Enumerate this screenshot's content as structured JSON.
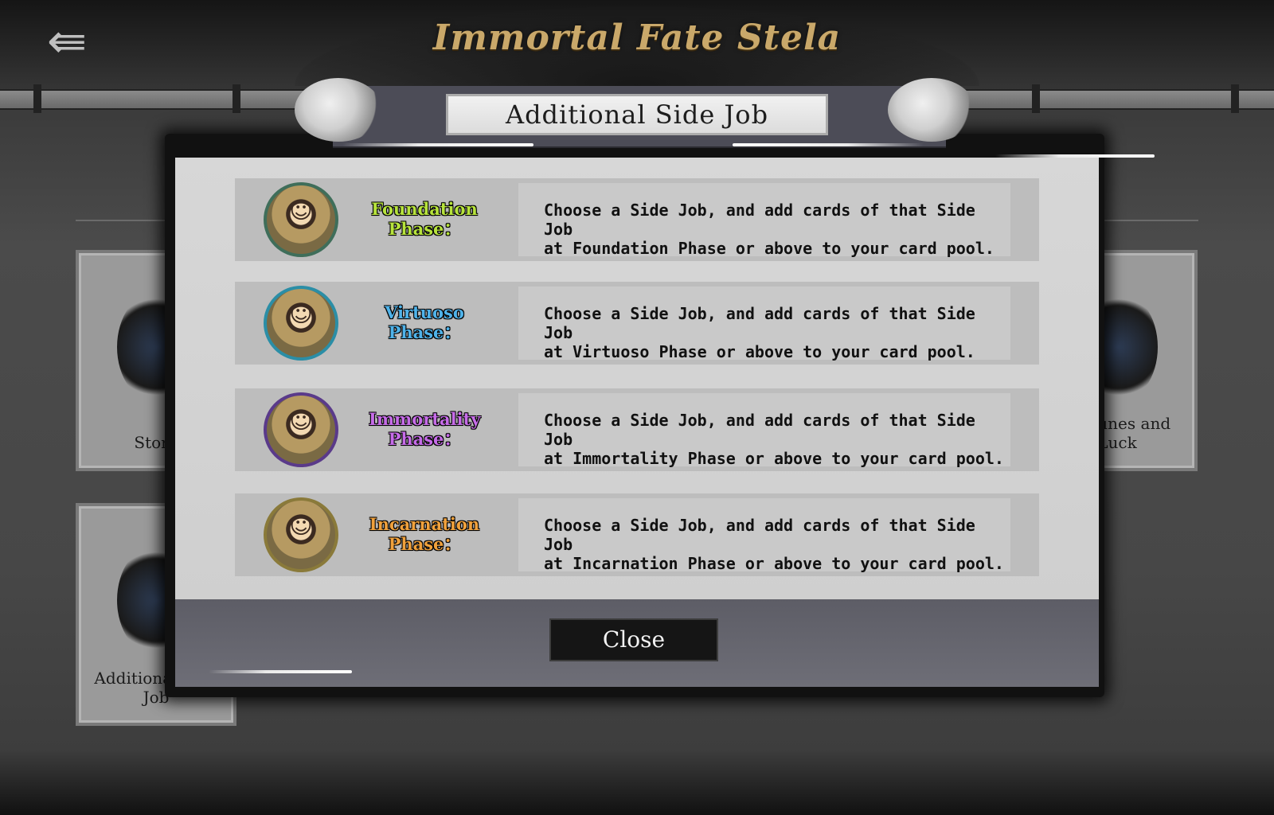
{
  "header": {
    "title": "Immortal Fate Stela",
    "back_icon": "back-arrow-icon",
    "title_color": "#c9a86a"
  },
  "background_cards": [
    {
      "label": "Store"
    },
    {
      "label": "Additional Side\nJob"
    },
    {
      "label": "Fortunes and\nLuck"
    }
  ],
  "modal": {
    "title": "Additional Side Job",
    "rows": [
      {
        "phase": "Foundation Phase：",
        "phase_color": "#b7e33c",
        "ring_color": "#3f6e5a",
        "description": "Choose a Side Job, and add cards of that Side Job\nat Foundation Phase or above to your card pool."
      },
      {
        "phase": "Virtuoso Phase：",
        "phase_color": "#4fb3ea",
        "ring_color": "#2b8ea6",
        "description": "Choose a Side Job, and add cards of that Side Job\nat Virtuoso Phase or above to your card pool."
      },
      {
        "phase": "Immortality Phase：",
        "phase_color": "#c66ce8",
        "ring_color": "#5a3a8a",
        "description": "Choose a Side Job, and add cards of that Side Job\nat Immortality Phase or above to your card pool."
      },
      {
        "phase": "Incarnation Phase：",
        "phase_color": "#f0a13c",
        "ring_color": "#8a7a3a",
        "description": "Choose a Side Job, and add cards of that Side Job\nat Incarnation Phase or above to your card pool."
      }
    ],
    "close_label": "Close"
  }
}
